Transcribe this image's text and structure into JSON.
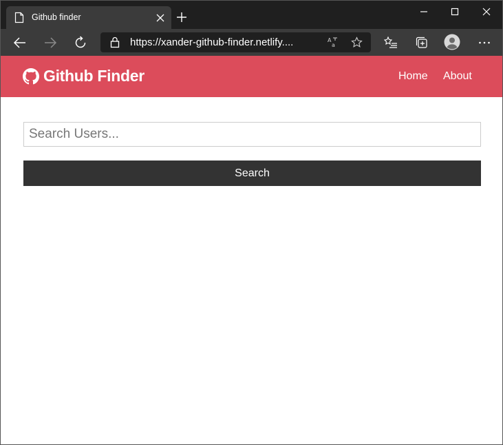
{
  "browser": {
    "tab": {
      "title": "Github finder",
      "page_icon": "page-icon",
      "close_icon": "close-icon"
    },
    "new_tab_icon": "plus-icon",
    "window_controls": [
      "minimize-icon",
      "maximize-icon",
      "close-icon"
    ],
    "toolbar": {
      "back_icon": "arrow-left-icon",
      "forward_icon": "arrow-right-icon",
      "reload_icon": "reload-icon",
      "favorites_icon": "favorites-list-icon",
      "collections_icon": "collections-icon",
      "profile_icon": "profile-avatar-icon",
      "more_icon": "more-dots-icon"
    },
    "address_bar": {
      "url": "https://xander-github-finder.netlify....",
      "lock_icon": "lock-icon",
      "read_aloud_icon": "read-aloud-icon",
      "favorite_icon": "star-icon"
    },
    "colors": {
      "tabstrip": "#1f1f1f",
      "toolbar": "#3b3b3b",
      "omnibox": "#1f1f1f"
    }
  },
  "app": {
    "navbar": {
      "brand": "Github Finder",
      "brand_icon": "github-icon",
      "links": [
        "Home",
        "About"
      ],
      "color": "#dc4c5b"
    },
    "search": {
      "placeholder": "Search Users...",
      "value": "",
      "button_label": "Search",
      "button_color": "#333333"
    }
  }
}
